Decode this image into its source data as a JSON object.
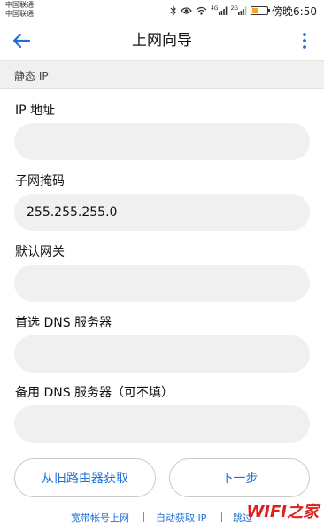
{
  "status_bar": {
    "carrier1": "中国联通",
    "carrier2": "中国联通",
    "time": "傍晚6:50",
    "net_label_1": "4G",
    "net_label_2": "2G",
    "battery_level": 0.35
  },
  "header": {
    "title": "上网向导"
  },
  "section": {
    "title": "静态 IP"
  },
  "form": {
    "ip_label": "IP 地址",
    "ip_value": "",
    "mask_label": "子网掩码",
    "mask_value": "255.255.255.0",
    "gateway_label": "默认网关",
    "gateway_value": "",
    "dns1_label": "首选 DNS 服务器",
    "dns1_value": "",
    "dns2_label": "备用 DNS 服务器（可不填）",
    "dns2_value": ""
  },
  "buttons": {
    "restore_label": "从旧路由器获取",
    "next_label": "下一步"
  },
  "links": {
    "broadband": "宽带帐号上网",
    "auto_ip": "自动获取 IP",
    "skip": "跳过"
  },
  "watermark": "WIFI之家",
  "colors": {
    "accent": "#1e6fd6",
    "input_bg": "#f0f0f0",
    "watermark": "#e02020"
  }
}
